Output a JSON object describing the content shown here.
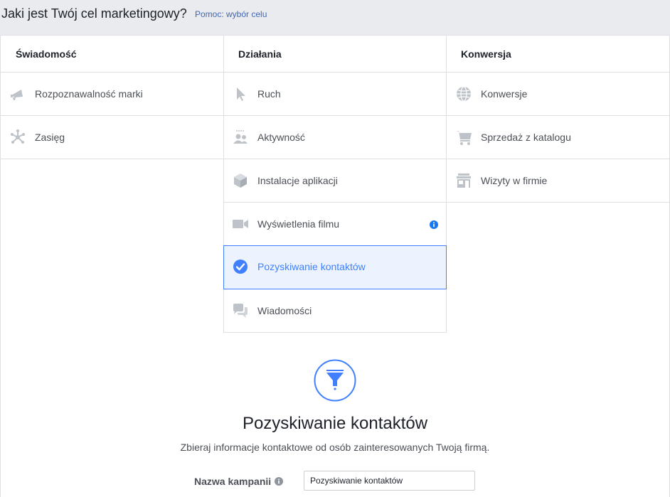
{
  "header": {
    "title": "Jaki jest Twój cel marketingowy?",
    "help_link": "Pomoc: wybór celu"
  },
  "columns": [
    {
      "title": "Świadomość",
      "items": [
        {
          "label": "Rozpoznawalność marki",
          "icon": "megaphone-icon"
        },
        {
          "label": "Zasięg",
          "icon": "reach-icon"
        }
      ]
    },
    {
      "title": "Działania",
      "items": [
        {
          "label": "Ruch",
          "icon": "cursor-icon"
        },
        {
          "label": "Aktywność",
          "icon": "people-icon"
        },
        {
          "label": "Instalacje aplikacji",
          "icon": "box-icon"
        },
        {
          "label": "Wyświetlenia filmu",
          "icon": "video-camera-icon",
          "has_info": true
        },
        {
          "label": "Pozyskiwanie kontaktów",
          "icon": "checkmark-circle-icon",
          "selected": true
        },
        {
          "label": "Wiadomości",
          "icon": "chat-bubbles-icon"
        }
      ]
    },
    {
      "title": "Konwersja",
      "items": [
        {
          "label": "Konwersje",
          "icon": "globe-icon"
        },
        {
          "label": "Sprzedaż z katalogu",
          "icon": "shopping-cart-icon"
        },
        {
          "label": "Wizyty w firmie",
          "icon": "storefront-icon"
        }
      ]
    }
  ],
  "detail": {
    "icon": "funnel-icon",
    "title": "Pozyskiwanie kontaktów",
    "description": "Zbieraj informacje kontaktowe od osób zainteresowanych Twoją firmą."
  },
  "campaign": {
    "label": "Nazwa kampanii",
    "value": "Pozyskiwanie kontaktów"
  },
  "colors": {
    "accent": "#4080ff",
    "selected_bg": "#ecf3ff",
    "icon_gray": "#bec3c9",
    "link": "#4267b2",
    "info_blue": "#1877f2"
  }
}
